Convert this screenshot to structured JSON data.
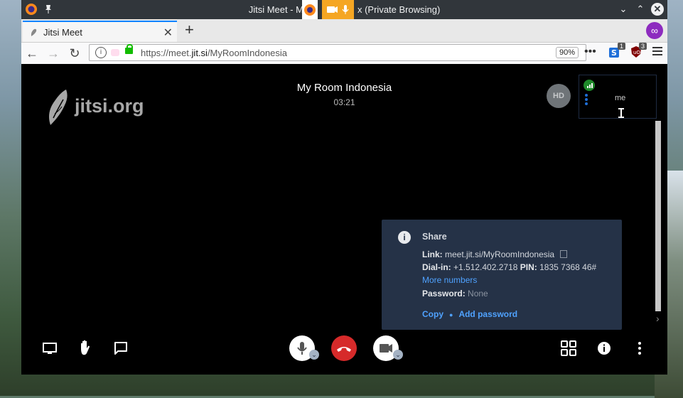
{
  "window": {
    "title": "Jitsi Meet - M",
    "title_suffix": "x (Private Browsing)"
  },
  "tab": {
    "label": "Jitsi Meet"
  },
  "address": {
    "url_prefix": "https://meet.",
    "url_domain": "jit.si",
    "url_path": "/MyRoomIndonesia",
    "zoom": "90%"
  },
  "extensions": [
    {
      "icon": "s-extension-icon",
      "badge": "1",
      "color": "#1e6fd9"
    },
    {
      "icon": "ublock-icon",
      "badge": "3",
      "color": "#800000"
    }
  ],
  "meeting": {
    "watermark": "jitsi.org",
    "room_name": "My Room Indonesia",
    "timer": "03:21",
    "quality_badge": "HD",
    "local_label": "me"
  },
  "share": {
    "title": "Share",
    "link_label": "Link:",
    "link_value": "meet.jit.si/MyRoomIndonesia",
    "dialin_label": "Dial-in:",
    "dialin_value": "+1.512.402.2718",
    "pin_label": "PIN:",
    "pin_value": "1835 7368 46#",
    "more_numbers": "More numbers",
    "password_label": "Password:",
    "password_value": "None",
    "copy": "Copy",
    "add_password": "Add password"
  },
  "colors": {
    "accent": "#4fa2ff",
    "panel": "#253247",
    "hangup": "#d62a2a"
  }
}
